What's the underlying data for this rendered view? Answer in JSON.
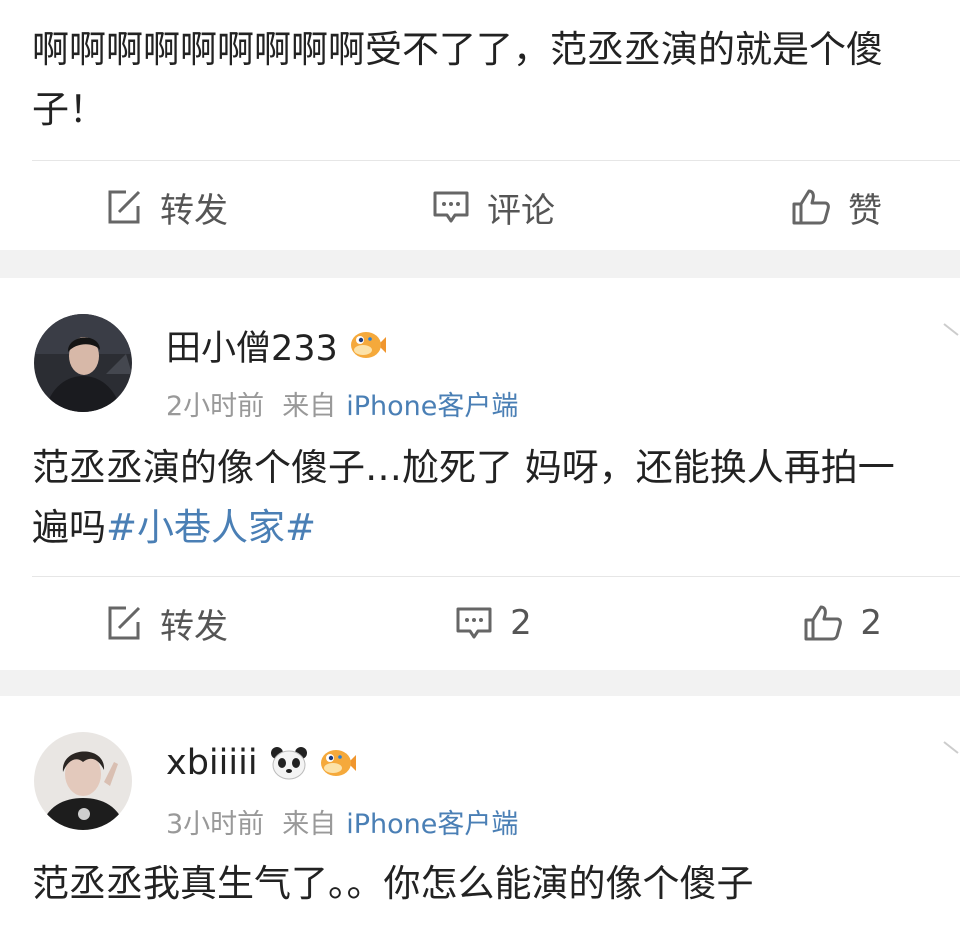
{
  "posts": [
    {
      "text": "啊啊啊啊啊啊啊啊啊受不了了，范丞丞演的就是个傻子！",
      "actions": {
        "repost": "转发",
        "comment": "评论",
        "like": "赞"
      }
    },
    {
      "username": "田小僧233",
      "time": "2小时前",
      "source_label": "来自",
      "source": "iPhone客户端",
      "text": "范丞丞演的像个傻子…尬死了 妈呀，还能换人再拍一遍吗",
      "topic": "#小巷人家#",
      "actions": {
        "repost": "转发",
        "comment": "2",
        "like": "2"
      }
    },
    {
      "username": "xbiiiii",
      "time": "3小时前",
      "source_label": "来自",
      "source": "iPhone客户端",
      "text": "范丞丞我真生气了。。你怎么能演的像个傻子"
    }
  ],
  "colors": {
    "link": "#4a7fb5",
    "meta": "#999999",
    "background": "#f2f2f2"
  },
  "icons": [
    "repost-icon",
    "comment-icon",
    "like-icon",
    "pufferfish-badge-icon",
    "panda-badge-icon",
    "chevron-icon"
  ]
}
